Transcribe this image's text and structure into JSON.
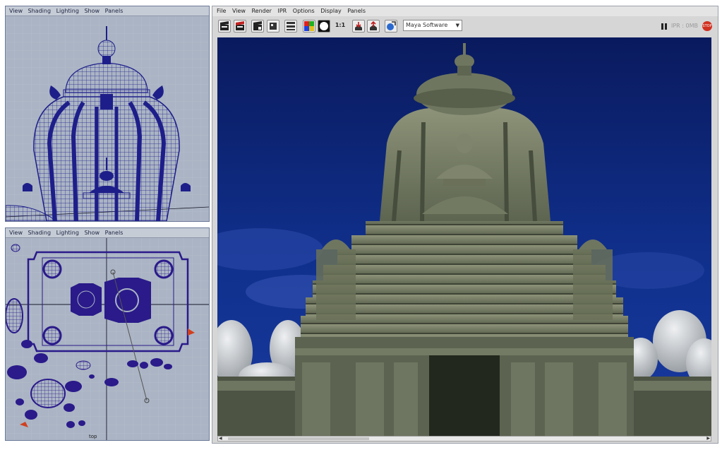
{
  "top_view_panel": {
    "menu": [
      "View",
      "Shading",
      "Lighting",
      "Show",
      "Panels"
    ]
  },
  "bottom_view_panel": {
    "menu": [
      "View",
      "Shading",
      "Lighting",
      "Show",
      "Panels"
    ],
    "axis_label": "top"
  },
  "render_view": {
    "menu": [
      "File",
      "View",
      "Render",
      "IPR",
      "Options",
      "Display",
      "Panels"
    ],
    "toolbar": {
      "ratio_label": "1:1",
      "renderer_select": "Maya Software",
      "ipr_label": "IPR : 0MB"
    },
    "icons": [
      "render-clapper-icon",
      "rerender-clapper-icon",
      "ipr-clapper-icon",
      "snapshot-icon",
      "render-settings-icon",
      "rgb-channels-icon",
      "alpha-channel-icon",
      "keep-image-icon",
      "remove-image-icon",
      "render-globals-icon",
      "pause-icon",
      "stop-icon"
    ],
    "colors": {
      "sky": "#0c1e6a",
      "stone": "#7c836a",
      "menu_bg": "#e4e4e4",
      "viewport_bg": "#aab4c4",
      "wire": "#1e1e8a"
    }
  }
}
